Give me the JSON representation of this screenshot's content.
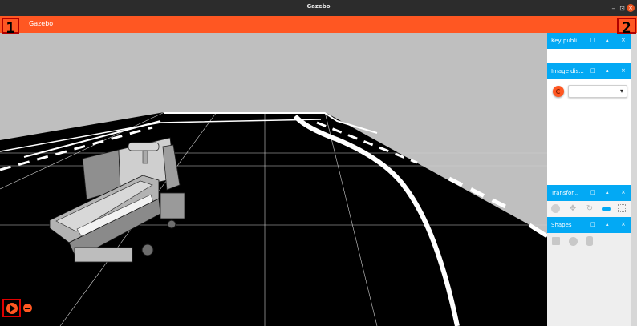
{
  "window": {
    "title": "Gazebo",
    "controls": {
      "minimize": "–",
      "maximize": "⊡",
      "close": "×"
    }
  },
  "app_bar": {
    "title": "Gazebo",
    "menu_icon": "hamburger-menu-icon"
  },
  "badges": {
    "left": "1",
    "right": "2"
  },
  "panels": [
    {
      "label": "Key publi...",
      "float": "□",
      "collapse": "▴",
      "close": "×"
    },
    {
      "label": "Image dis...",
      "float": "□",
      "collapse": "▴",
      "close": "×"
    },
    {
      "label": "Transfor...",
      "float": "□",
      "collapse": "▴",
      "close": "×"
    },
    {
      "label": "Shapes",
      "float": "□",
      "collapse": "▴",
      "close": "×"
    }
  ],
  "image_display": {
    "topic_value": "",
    "dropdown_icon": "▾"
  },
  "transform_tools": [
    "select-icon",
    "translate-icon",
    "rotate-icon",
    "snap-icon",
    "grid-icon"
  ],
  "shapes": [
    "box-icon",
    "sphere-icon",
    "cylinder-icon"
  ],
  "colors": {
    "accent": "#ff5722",
    "panel_header": "#03a9f4",
    "sky": "#bdbdbd",
    "ground": "#000000"
  }
}
